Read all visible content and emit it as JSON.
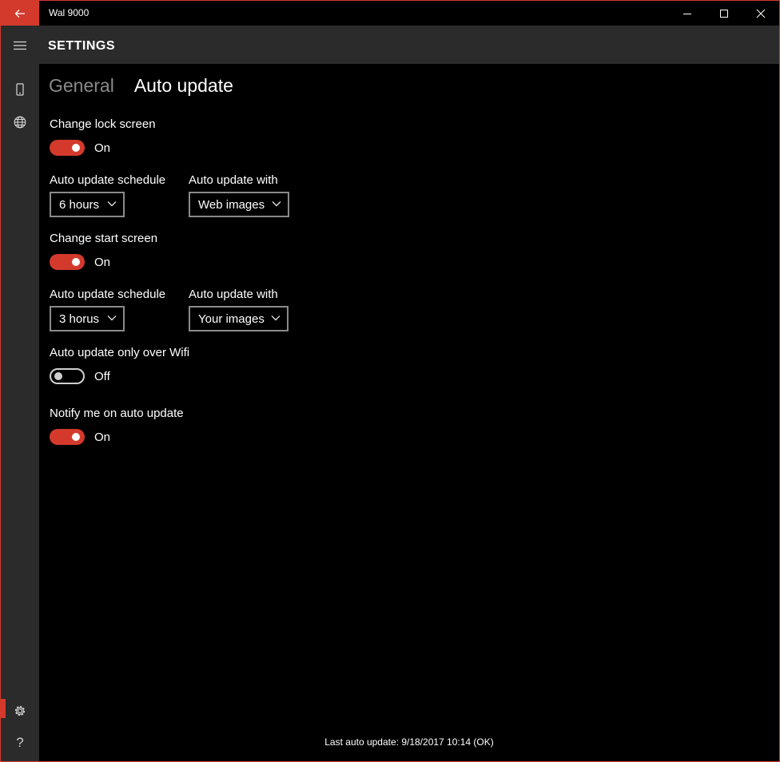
{
  "window": {
    "title": "Wal 9000"
  },
  "header": {
    "title": "SETTINGS"
  },
  "icons": {
    "back": "back-arrow-icon",
    "minimize": "minimize-icon",
    "maximize": "maximize-icon",
    "close": "close-icon",
    "hamburger": "hamburger-menu-icon",
    "device": "phone-device-icon",
    "globe": "globe-icon",
    "settings": "gear-icon",
    "help": "question-mark-icon"
  },
  "sidebar": {
    "help_glyph": "?"
  },
  "tabs": [
    {
      "label": "General",
      "active": false
    },
    {
      "label": "Auto update",
      "active": true
    }
  ],
  "lock_screen": {
    "label": "Change lock screen",
    "toggle_state": "On",
    "schedule_label": "Auto update schedule",
    "schedule_value": "6 hours",
    "source_label": "Auto update with",
    "source_value": "Web images"
  },
  "start_screen": {
    "label": "Change start screen",
    "toggle_state": "On",
    "schedule_label": "Auto update schedule",
    "schedule_value": "3 horus",
    "source_label": "Auto update with",
    "source_value": "Your images"
  },
  "wifi_only": {
    "label": "Auto update only over Wifi",
    "toggle_state": "Off"
  },
  "notify": {
    "label": "Notify me on auto update",
    "toggle_state": "On"
  },
  "status": {
    "text": "Last auto update: 9/18/2017 10:14 (OK)"
  },
  "colors": {
    "accent": "#d33a2c",
    "chrome": "#2b2b2b",
    "background": "#000000"
  }
}
